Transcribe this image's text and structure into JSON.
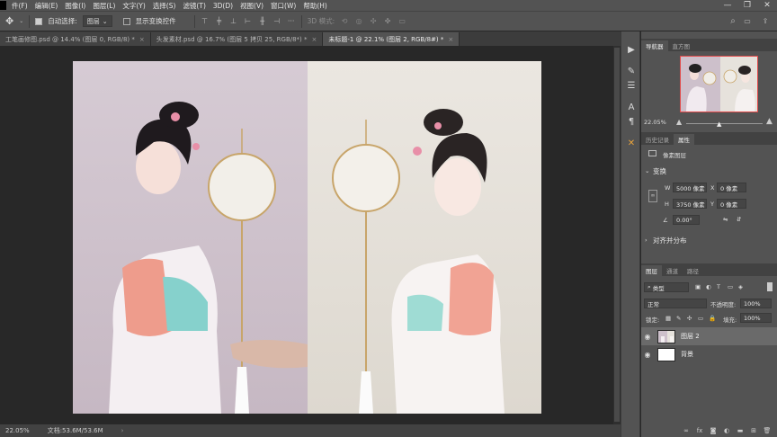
{
  "menubar": {
    "items": [
      "件(F)",
      "编辑(E)",
      "图像(I)",
      "图层(L)",
      "文字(Y)",
      "选择(S)",
      "滤镜(T)",
      "3D(D)",
      "视图(V)",
      "窗口(W)",
      "帮助(H)"
    ],
    "window_controls": [
      "—",
      "❐",
      "✕"
    ]
  },
  "options": {
    "auto_select_label": "自动选择:",
    "auto_select_value": "图层",
    "show_transform_label": "显示变换控件",
    "mode_3d_label": "3D 模式:"
  },
  "tabs": [
    {
      "label": "工笔画修图.psd @ 14.4% (图层 0, RGB/8) *",
      "active": false
    },
    {
      "label": "头发素材.psd @ 16.7% (图层 5 拷贝 25, RGB/8*) *",
      "active": false
    },
    {
      "label": "未标题-1 @ 22.1% (图层 2, RGB/8#) *",
      "active": true
    }
  ],
  "status": {
    "zoom": "22.05%",
    "doc_info": "文档:53.6M/53.6M"
  },
  "tools": {
    "icons": [
      "play-icon",
      "brush-settings-icon",
      "sliders-icon",
      "character-icon",
      "paragraph-icon",
      "tools-cross-icon"
    ]
  },
  "navigator": {
    "tab_label": "导航器",
    "histogram_label": "直方图",
    "zoom": "22.05%"
  },
  "history": {
    "tab_label": "历史记录",
    "properties_label": "属性"
  },
  "properties": {
    "pixel_layer": "像素图层",
    "transform_title": "变换",
    "w_label": "W",
    "w_value": "5000 像素",
    "h_label": "H",
    "h_value": "3750 像素",
    "x_label": "X",
    "x_value": "0 像素",
    "y_label": "Y",
    "y_value": "0 像素",
    "angle_value": "0.00°",
    "align_title": "对齐并分布"
  },
  "layers": {
    "tab_layers": "图层",
    "tab_channels": "通道",
    "tab_paths": "路径",
    "filter_kind": "类型",
    "blend_mode": "正常",
    "opacity_label": "不透明度:",
    "opacity_value": "100%",
    "lock_label": "锁定:",
    "fill_label": "填充:",
    "fill_value": "100%",
    "rows": [
      {
        "name": "图层 2",
        "selected": true
      },
      {
        "name": "背景",
        "selected": false
      }
    ],
    "bottom_icons": [
      "link-icon",
      "fx-icon",
      "mask-icon",
      "adjustment-icon",
      "folder-icon",
      "new-layer-icon",
      "trash-icon"
    ]
  },
  "colors": {
    "panel_bg": "#535353",
    "dark_bg": "#282828",
    "nav_frame": "#e24b4b",
    "left_photo_bg": "#cdc0cb",
    "right_photo_bg": "#e6e2dc"
  }
}
